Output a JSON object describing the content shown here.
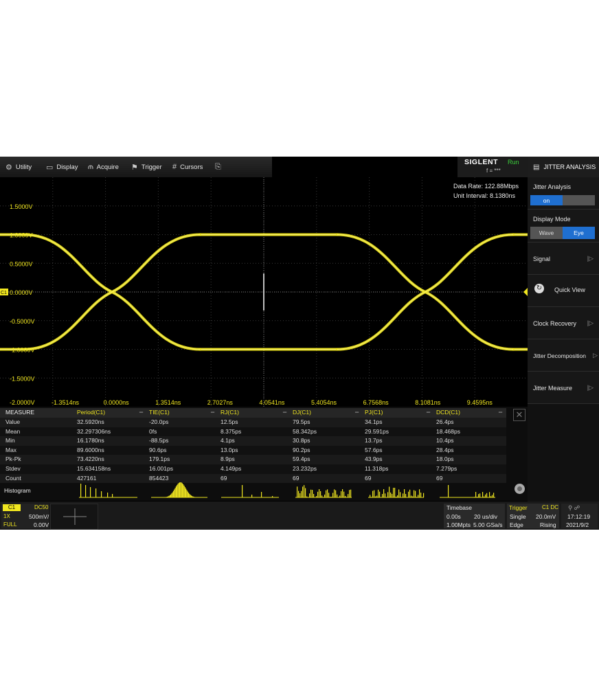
{
  "menu": {
    "utility": "Utility",
    "display": "Display",
    "acquire": "Acquire",
    "trigger": "Trigger",
    "cursors": "Cursors"
  },
  "brand": {
    "logo": "SIGLENT",
    "status": "Run",
    "freq": "f = ***"
  },
  "panel": {
    "title": "JITTER ANALYSIS",
    "jitter_analysis_label": "Jitter Analysis",
    "jitter_on": "on",
    "display_mode_label": "Display Mode",
    "mode_wave": "Wave",
    "mode_eye": "Eye",
    "signal": "Signal",
    "quick_view": "Quick View",
    "clock_recovery": "Clock Recovery",
    "jitter_decomposition": "Jitter Decomposition",
    "jitter_measure": "Jitter Measure"
  },
  "waveform": {
    "data_rate": "Data Rate: 122.88Mbps",
    "unit_interval": "Unit Interval: 8.1380ns",
    "channel_marker": "C1",
    "volt_labels": [
      "1.5000V",
      "1.0000V",
      "0.5000V",
      "0.0000V",
      "-0.5000V",
      "-1.0000V",
      "-1.5000V",
      "-2.0000V"
    ],
    "time_labels": [
      "-1.3514ns",
      "0.0000ns",
      "1.3514ns",
      "2.7027ns",
      "4.0541ns",
      "5.4054ns",
      "6.7568ns",
      "8.1081ns",
      "9.4595ns"
    ],
    "trace_color": "#f0e620"
  },
  "measure": {
    "header": "MEASURE",
    "columns": [
      "Period(C1)",
      "TIE(C1)",
      "RJ(C1)",
      "DJ(C1)",
      "PJ(C1)",
      "DCD(C1)"
    ],
    "rows": [
      {
        "label": "Value",
        "cells": [
          "32.5920ns",
          "-20.0ps",
          "12.5ps",
          "79.5ps",
          "34.1ps",
          "26.4ps"
        ]
      },
      {
        "label": "Mean",
        "cells": [
          "32.297306ns",
          "0fs",
          "8.375ps",
          "58.342ps",
          "29.591ps",
          "18.468ps"
        ]
      },
      {
        "label": "Min",
        "cells": [
          "16.1780ns",
          "-88.5ps",
          "4.1ps",
          "30.8ps",
          "13.7ps",
          "10.4ps"
        ]
      },
      {
        "label": "Max",
        "cells": [
          "89.6000ns",
          "90.6ps",
          "13.0ps",
          "90.2ps",
          "57.6ps",
          "28.4ps"
        ]
      },
      {
        "label": "Pk-Pk",
        "cells": [
          "73.4220ns",
          "179.1ps",
          "8.9ps",
          "59.4ps",
          "43.9ps",
          "18.0ps"
        ]
      },
      {
        "label": "Stdev",
        "cells": [
          "15.634158ns",
          "16.001ps",
          "4.149ps",
          "23.232ps",
          "11.318ps",
          "7.279ps"
        ]
      },
      {
        "label": "Count",
        "cells": [
          "427161",
          "854423",
          "69",
          "69",
          "69",
          "69"
        ]
      }
    ],
    "histogram_label": "Histogram"
  },
  "channel": {
    "name": "C1",
    "coupling": "DC50",
    "probe": "1X",
    "scale": "500mV/",
    "bw": "FULL",
    "offset": "0.00V"
  },
  "timebase": {
    "title": "Timebase",
    "delay": "0.00s",
    "scale": "20 us/div",
    "points": "1.00Mpts",
    "rate": "5.00 GSa/s"
  },
  "trigger": {
    "title": "Trigger",
    "source": "C1 DC",
    "mode": "Single",
    "level": "20.0mV",
    "type": "Edge",
    "slope": "Rising"
  },
  "clock": {
    "time": "17:12:19",
    "date": "2021/9/2"
  }
}
